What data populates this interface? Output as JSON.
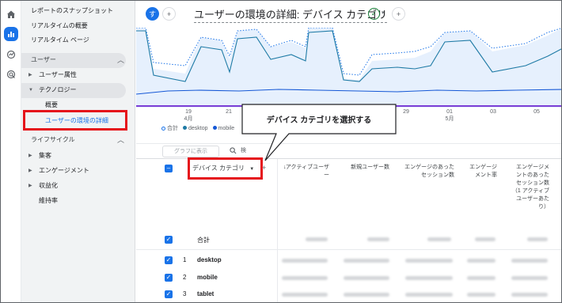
{
  "nav": {
    "top_items": [
      "レポートのスナップショット",
      "リアルタイムの概要",
      "リアルタイム ページ"
    ],
    "section_user": "ユーザー",
    "user_attr": "ユーザー属性",
    "technology": "テクノロジー",
    "overview": "概要",
    "user_env_detail": "ユーザーの環境の詳細",
    "section_lifecycle": "ライフサイクル",
    "acquisition": "集客",
    "engagement": "エンゲージメント",
    "monetization": "収益化",
    "retention": "維持率"
  },
  "header": {
    "avatar_letter": "す",
    "add_symbol": "+",
    "title": "ユーザーの環境の詳細: デバイス カテゴリ",
    "check_symbol": "✓",
    "caret": "▾",
    "add_symbol_2": "+"
  },
  "chart": {
    "ticks": [
      {
        "day": "19",
        "month": "4月"
      },
      {
        "day": "21",
        "month": ""
      },
      {
        "day": "23",
        "month": ""
      },
      {
        "day": "25",
        "month": ""
      },
      {
        "day": "27",
        "month": ""
      },
      {
        "day": "29",
        "month": ""
      },
      {
        "day": "01",
        "month": "5月"
      },
      {
        "day": "03",
        "month": ""
      },
      {
        "day": "05",
        "month": ""
      }
    ],
    "legend": [
      "合計",
      "desktop",
      "mobile"
    ],
    "colors": {
      "total": "#1a73e8",
      "desktop": "#1e7aa5",
      "mobile": "#1558d6",
      "band": "#d2e3fc",
      "baseline": "#7b3fd6"
    }
  },
  "callout": {
    "text": "デバイス カテゴリを選択する"
  },
  "toolbar": {
    "graph_button": "グラフに表示",
    "search_text": "検"
  },
  "table": {
    "dimension": "デバイス カテゴリ",
    "headers": [
      "アクティブユーザー",
      "新規ユーザー数",
      "エンゲージのあったセッション数",
      "エンゲージメント率",
      "エンゲージメントのあったセッション数（1 アクティブユーザーあたり）"
    ],
    "total_label": "合計",
    "rows": [
      {
        "index": "1",
        "label": "desktop"
      },
      {
        "index": "2",
        "label": "mobile"
      },
      {
        "index": "3",
        "label": "tablet"
      }
    ]
  }
}
